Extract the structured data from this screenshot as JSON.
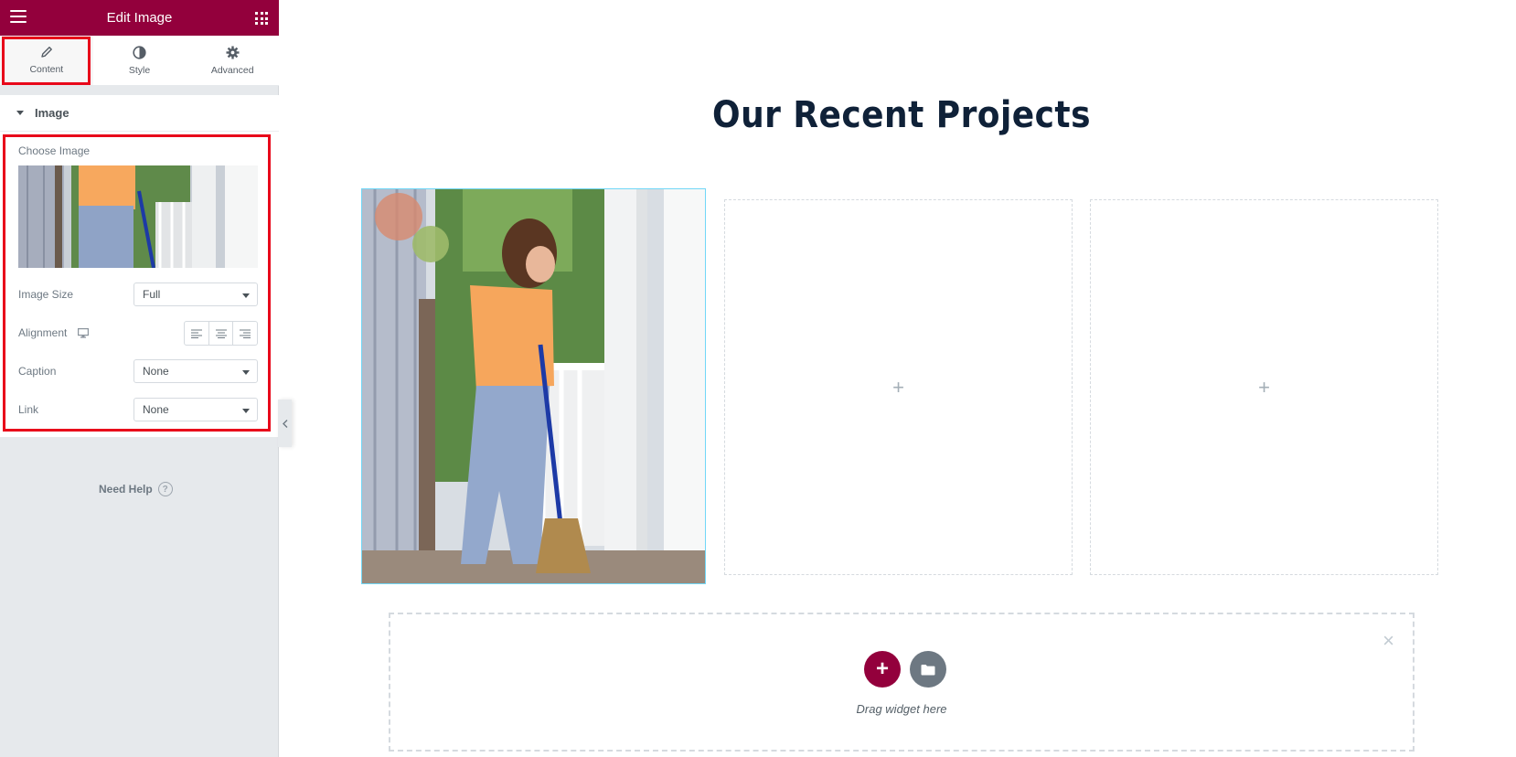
{
  "panel": {
    "title": "Edit Image",
    "tabs": [
      {
        "label": "Content",
        "icon": "pencil-icon"
      },
      {
        "label": "Style",
        "icon": "half-circle-icon"
      },
      {
        "label": "Advanced",
        "icon": "gear-icon"
      }
    ],
    "section_title": "Image",
    "choose_image_label": "Choose Image",
    "image_size": {
      "label": "Image Size",
      "value": "Full"
    },
    "alignment": {
      "label": "Alignment"
    },
    "caption": {
      "label": "Caption",
      "value": "None"
    },
    "link": {
      "label": "Link",
      "value": "None"
    },
    "need_help": "Need Help"
  },
  "canvas": {
    "heading": "Our Recent Projects",
    "add_placeholder": "+",
    "drop_text": "Drag widget here",
    "add_icon": "+",
    "close_icon": "×"
  },
  "colors": {
    "brand": "#93003c",
    "highlight": "#e8081a",
    "heading": "#0f2138"
  }
}
